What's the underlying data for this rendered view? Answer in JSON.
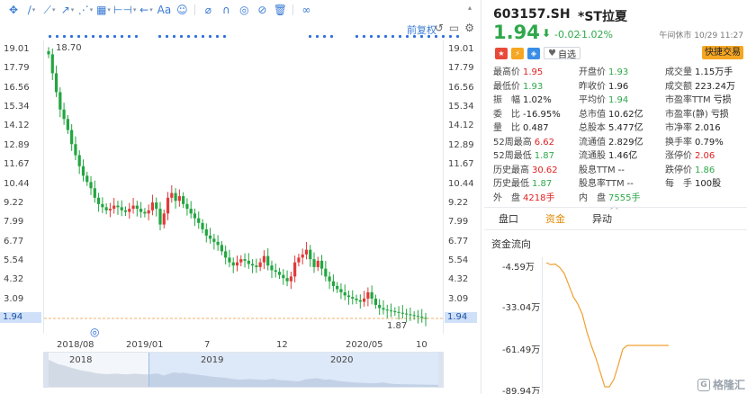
{
  "toolbar": {
    "icons": [
      "move-icon",
      "pencil-icon",
      "line-icon",
      "trend-icon",
      "ruler-icon",
      "measure-icon",
      "arrow-icon",
      "font-icon",
      "brush-icon",
      "magnet-icon",
      "hide-icon",
      "lock-icon",
      "trash-icon",
      "link-icon"
    ],
    "font_label": "Aa"
  },
  "chart_header": {
    "restore_label": "前复权"
  },
  "chart_data": {
    "type": "candlestick",
    "y_ticks": [
      "19.01",
      "17.79",
      "16.56",
      "15.34",
      "14.12",
      "12.89",
      "11.67",
      "10.44",
      "9.22",
      "7.99",
      "6.77",
      "5.54",
      "4.32",
      "3.09",
      "1.94"
    ],
    "ylim": [
      1.94,
      19.01
    ],
    "x_labels": [
      "2018/08",
      "2019/01",
      "7",
      "12",
      "2020/05",
      "10"
    ],
    "annotations": [
      {
        "text": "18.70",
        "note": "high"
      },
      {
        "text": "1.87",
        "note": "low"
      }
    ],
    "last_price": "1.94",
    "close_series": [
      18.7,
      17.5,
      16.3,
      15.2,
      14.6,
      13.9,
      13.0,
      12.3,
      11.6,
      11.0,
      10.6,
      10.2,
      9.6,
      9.2,
      9.0,
      8.8,
      8.9,
      9.1,
      9.0,
      8.8,
      8.7,
      8.9,
      9.1,
      8.9,
      8.7,
      8.6,
      8.8,
      9.3,
      8.9,
      7.9,
      8.6,
      9.6,
      9.9,
      9.4,
      9.7,
      9.2,
      8.9,
      8.6,
      8.3,
      8.0,
      7.6,
      7.2,
      7.0,
      6.8,
      6.6,
      6.2,
      5.8,
      5.5,
      5.3,
      5.5,
      5.7,
      5.6,
      5.4,
      5.3,
      5.2,
      5.5,
      5.9,
      5.3,
      5.0,
      4.9,
      4.7,
      4.5,
      4.3,
      4.6,
      5.5,
      5.8,
      6.0,
      6.3,
      5.7,
      5.2,
      5.6,
      5.1,
      4.6,
      4.3,
      4.0,
      3.8,
      3.6,
      3.4,
      3.3,
      3.2,
      3.1,
      3.0,
      3.2,
      3.6,
      3.2,
      2.8,
      2.6,
      2.5,
      2.45,
      2.4,
      2.35,
      2.3,
      2.25,
      2.2,
      2.15,
      2.1,
      2.05,
      1.98,
      1.94
    ],
    "nav_years": [
      "2018",
      "2019",
      "2020"
    ]
  },
  "quote": {
    "code": "603157.SH",
    "name": "*ST拉夏",
    "price": "1.94",
    "arrow": "⬇",
    "change": "-0.02",
    "change_pct": "-1.02%",
    "status": "午间休市 10/29 11:27",
    "watch_label": "自选",
    "quick_trade": "快捷交易"
  },
  "stats": [
    [
      {
        "l": "最高价",
        "v": "1.95",
        "c": "up"
      },
      {
        "l": "开盘价",
        "v": "1.93",
        "c": "down"
      },
      {
        "l": "成交量",
        "v": "1.15万手",
        "c": ""
      }
    ],
    [
      {
        "l": "最低价",
        "v": "1.93",
        "c": "down"
      },
      {
        "l": "昨收价",
        "v": "1.96",
        "c": ""
      },
      {
        "l": "成交额",
        "v": "223.24万",
        "c": ""
      }
    ],
    [
      {
        "l": "振　幅",
        "v": "1.02%",
        "c": ""
      },
      {
        "l": "平均价",
        "v": "1.94",
        "c": "down"
      },
      {
        "l": "市盈率TTM",
        "v": "亏损",
        "c": ""
      }
    ],
    [
      {
        "l": "委　比",
        "v": "-16.95%",
        "c": ""
      },
      {
        "l": "总市值",
        "v": "10.62亿",
        "c": ""
      },
      {
        "l": "市盈率(静)",
        "v": "亏损",
        "c": ""
      }
    ],
    [
      {
        "l": "量　比",
        "v": "0.487",
        "c": ""
      },
      {
        "l": "总股本",
        "v": "5.477亿",
        "c": ""
      },
      {
        "l": "市净率",
        "v": "2.016",
        "c": ""
      }
    ],
    [
      {
        "l": "52周最高",
        "v": "6.62",
        "c": "up"
      },
      {
        "l": "流通值",
        "v": "2.829亿",
        "c": ""
      },
      {
        "l": "换手率",
        "v": "0.79%",
        "c": ""
      }
    ],
    [
      {
        "l": "52周最低",
        "v": "1.87",
        "c": "down"
      },
      {
        "l": "流通股",
        "v": "1.46亿",
        "c": ""
      },
      {
        "l": "涨停价",
        "v": "2.06",
        "c": "up"
      }
    ],
    [
      {
        "l": "历史最高",
        "v": "30.62",
        "c": "up"
      },
      {
        "l": "股息TTM",
        "v": "--",
        "c": ""
      },
      {
        "l": "跌停价",
        "v": "1.86",
        "c": "down"
      }
    ],
    [
      {
        "l": "历史最低",
        "v": "1.87",
        "c": "down"
      },
      {
        "l": "股息率TTM",
        "v": "--",
        "c": ""
      },
      {
        "l": "每　手",
        "v": "100股",
        "c": ""
      }
    ],
    [
      {
        "l": "外　盘",
        "v": "4218手",
        "c": "up"
      },
      {
        "l": "内　盘",
        "v": "7555手",
        "c": "down"
      },
      {
        "l": "",
        "v": "",
        "c": ""
      }
    ]
  ],
  "tabs": [
    {
      "label": "盘口",
      "active": false
    },
    {
      "label": "资金",
      "active": true
    },
    {
      "label": "异动",
      "active": false
    }
  ],
  "cash_flow": {
    "title": "资金流向",
    "y_labels": [
      "-4.59万",
      "-33.04万",
      "-61.49万",
      "-89.94万"
    ],
    "values": [
      -4.59,
      -6,
      -5.5,
      -8,
      -12,
      -20,
      -28,
      -33.04,
      -40,
      -52,
      -61.49,
      -70,
      -80,
      -89.94,
      -89.94,
      -85,
      -75,
      -64,
      -61.49,
      -61.49,
      -61.49
    ]
  },
  "watermark": "格隆汇"
}
